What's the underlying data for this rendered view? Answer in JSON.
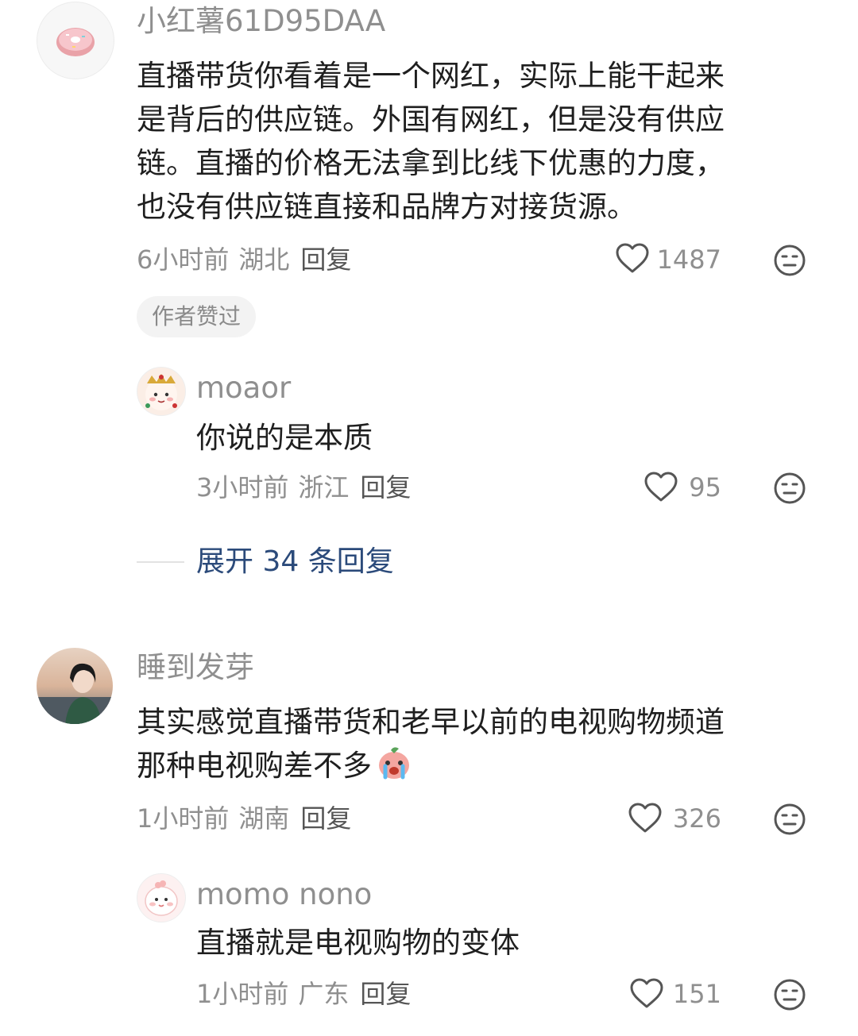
{
  "comments": [
    {
      "author": "小红薯61D95DAA",
      "content_lines": [
        "直播带货你看着是一个网红，实际上能干起来",
        "是背后的供应链。外国有网红，但是没有供应",
        "链。直播的价格无法拿到比线下优惠的力度，",
        "也没有供应链直接和品牌方对接货源。"
      ],
      "time": "6小时前",
      "location": "湖北",
      "reply_label": "回复",
      "likes": "1487",
      "badge": "作者赞过",
      "replies": [
        {
          "author": "moaor",
          "content": "你说的是本质",
          "time": "3小时前",
          "location": "浙江",
          "reply_label": "回复",
          "likes": "95"
        }
      ],
      "expand_label": "展开 34 条回复"
    },
    {
      "author": "睡到发芽",
      "content_lines": [
        "其实感觉直播带货和老早以前的电视购物频道",
        "那种电视购差不多"
      ],
      "time": "1小时前",
      "location": "湖南",
      "reply_label": "回复",
      "likes": "326",
      "replies": [
        {
          "author": "momo nono",
          "content": "直播就是电视购物的变体",
          "time": "1小时前",
          "location": "广东",
          "reply_label": "回复",
          "likes": "151"
        }
      ]
    }
  ],
  "icons": {
    "like": "heart-outline-icon",
    "dislike": "neutral-face-icon",
    "emoji": "crying-sticker-emoji"
  },
  "colors": {
    "author": "#8f8f8f",
    "content": "#1f1f1f",
    "expand": "#2b4a7a",
    "badge_bg": "#f3f3f3"
  }
}
